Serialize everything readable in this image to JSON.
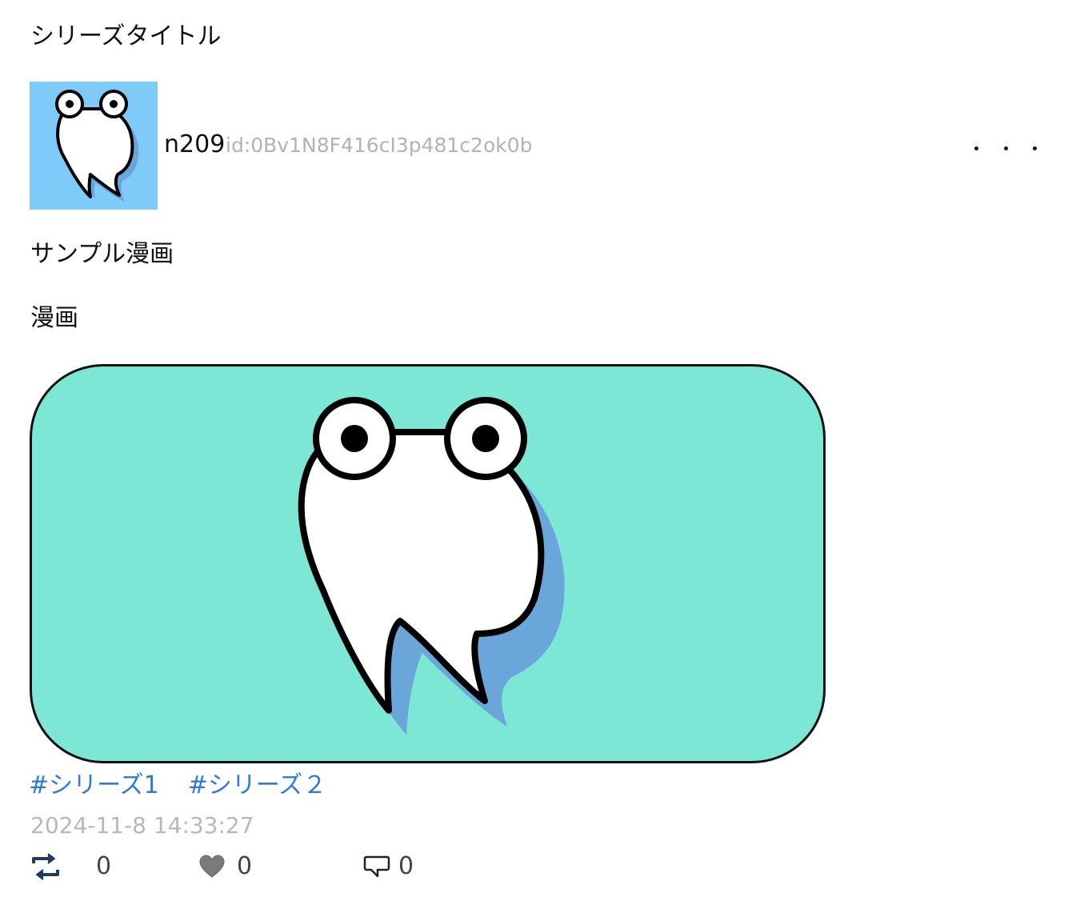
{
  "series": {
    "title": "シリーズタイトル"
  },
  "author": {
    "name": "n209",
    "id": "id:0Bv1N8F416cI3p481c2ok0b",
    "avatar_icon": "tooth-mascot-icon",
    "avatar_bg": "#7ecbf9"
  },
  "post": {
    "title": "サンプル漫画",
    "body": "漫画",
    "image_icon": "tooth-mascot-icon",
    "image_bg": "#7de7d6",
    "tags": [
      "#シリーズ1",
      "#シリーズ２"
    ],
    "timestamp": "2024-11-8 14:33:27"
  },
  "actions": {
    "repost": {
      "icon": "repost-icon",
      "count": "0"
    },
    "like": {
      "icon": "heart-icon",
      "count": "0"
    },
    "reply": {
      "icon": "speech-bubble-icon",
      "count": "0"
    }
  },
  "more": {
    "icon": "more-dots-icon"
  },
  "colors": {
    "tag": "#2f7ad6",
    "muted": "#b3b3b3",
    "text": "#111111"
  }
}
